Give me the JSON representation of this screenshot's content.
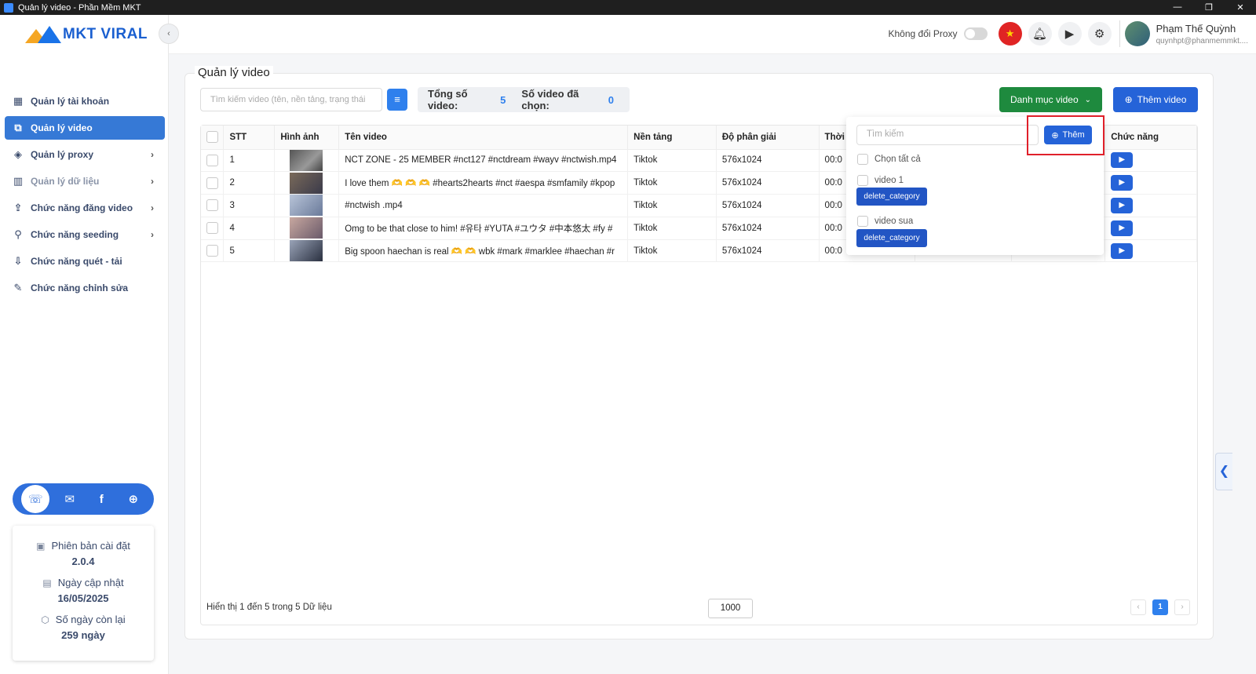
{
  "window": {
    "title": "Quản lý video - Phần Mềm MKT",
    "controls": [
      "—",
      "❐",
      "✕"
    ]
  },
  "logo": {
    "text": "MKT VIRAL"
  },
  "sidebar": {
    "items": [
      {
        "label": "Quản lý tài khoản",
        "icon": "grid-icon",
        "chevron": false,
        "active": false,
        "dim": false
      },
      {
        "label": "Quản lý video",
        "icon": "video-icon",
        "chevron": false,
        "active": true,
        "dim": false
      },
      {
        "label": "Quản lý proxy",
        "icon": "layers-icon",
        "chevron": true,
        "active": false,
        "dim": false
      },
      {
        "label": "Quản lý dữ liệu",
        "icon": "chart-icon",
        "chevron": true,
        "active": false,
        "dim": true
      },
      {
        "label": "Chức năng đăng video",
        "icon": "upload-icon",
        "chevron": true,
        "active": false,
        "dim": false
      },
      {
        "label": "Chức năng seeding",
        "icon": "seeding-icon",
        "chevron": true,
        "active": false,
        "dim": false
      },
      {
        "label": "Chức năng quét - tải",
        "icon": "download-icon",
        "chevron": false,
        "active": false,
        "dim": false
      },
      {
        "label": "Chức năng chỉnh sửa",
        "icon": "edit-icon",
        "chevron": false,
        "active": false,
        "dim": false
      }
    ],
    "info": {
      "version_label": "Phiên bản cài đặt",
      "version_value": "2.0.4",
      "update_label": "Ngày cập nhật",
      "update_value": "16/05/2025",
      "days_label": "Số ngày còn lại",
      "days_value": "259 ngày"
    }
  },
  "header": {
    "proxy_label": "Không đổi Proxy",
    "user_name": "Phạm Thế Quỳnh",
    "user_email": "quynhpt@phanmemmkt...."
  },
  "main": {
    "title": "Quản lý video",
    "search_placeholder": "Tìm kiếm video (tên, nền tảng, trạng thái",
    "total_label": "Tổng số video:",
    "total_value": "5",
    "selected_label": "Số video đã chọn:",
    "selected_value": "0",
    "category_button": "Danh mục video",
    "add_button": "Thêm video"
  },
  "table": {
    "headers": [
      "STT",
      "Hình ảnh",
      "Tên video",
      "Nền tảng",
      "Độ phân giải",
      "Thời",
      "",
      "",
      "Chức năng"
    ],
    "rows": [
      {
        "stt": "1",
        "name": "NCT ZONE - 25 MEMBER #nct127 #nctdream #wayv #nctwish.mp4",
        "platform": "Tiktok",
        "resolution": "576x1024",
        "time": "00:0"
      },
      {
        "stt": "2",
        "name": "I love them 🫶 🫶 🫶 #hearts2hearts #nct #aespa #smfamily #kpop",
        "platform": "Tiktok",
        "resolution": "576x1024",
        "time": "00:0"
      },
      {
        "stt": "3",
        "name": "#nctwish .mp4",
        "platform": "Tiktok",
        "resolution": "576x1024",
        "time": "00:0"
      },
      {
        "stt": "4",
        "name": "Omg to be that close to him! #유타 #YUTA #ユウタ #中本悠太 #fy #",
        "platform": "Tiktok",
        "resolution": "576x1024",
        "time": "00:0"
      },
      {
        "stt": "5",
        "name": "Big spoon haechan is real 🫶 🫶 wbk #mark #marklee #haechan #r",
        "platform": "Tiktok",
        "resolution": "576x1024",
        "time": "00:0"
      }
    ],
    "footer_text": "Hiển thị 1 đến 5 trong 5 Dữ liệu",
    "page_size": "1000",
    "current_page": "1"
  },
  "dropdown": {
    "search_placeholder": "Tìm kiếm",
    "add_label": "Thêm",
    "select_all": "Chọn tất cả",
    "categories": [
      {
        "name": "video 1",
        "delete_label": "delete_category"
      },
      {
        "name": "video sua",
        "delete_label": "delete_category"
      }
    ]
  },
  "colors": {
    "primary": "#2563d8",
    "green": "#1e8a3e",
    "highlight": "#e0202a"
  }
}
